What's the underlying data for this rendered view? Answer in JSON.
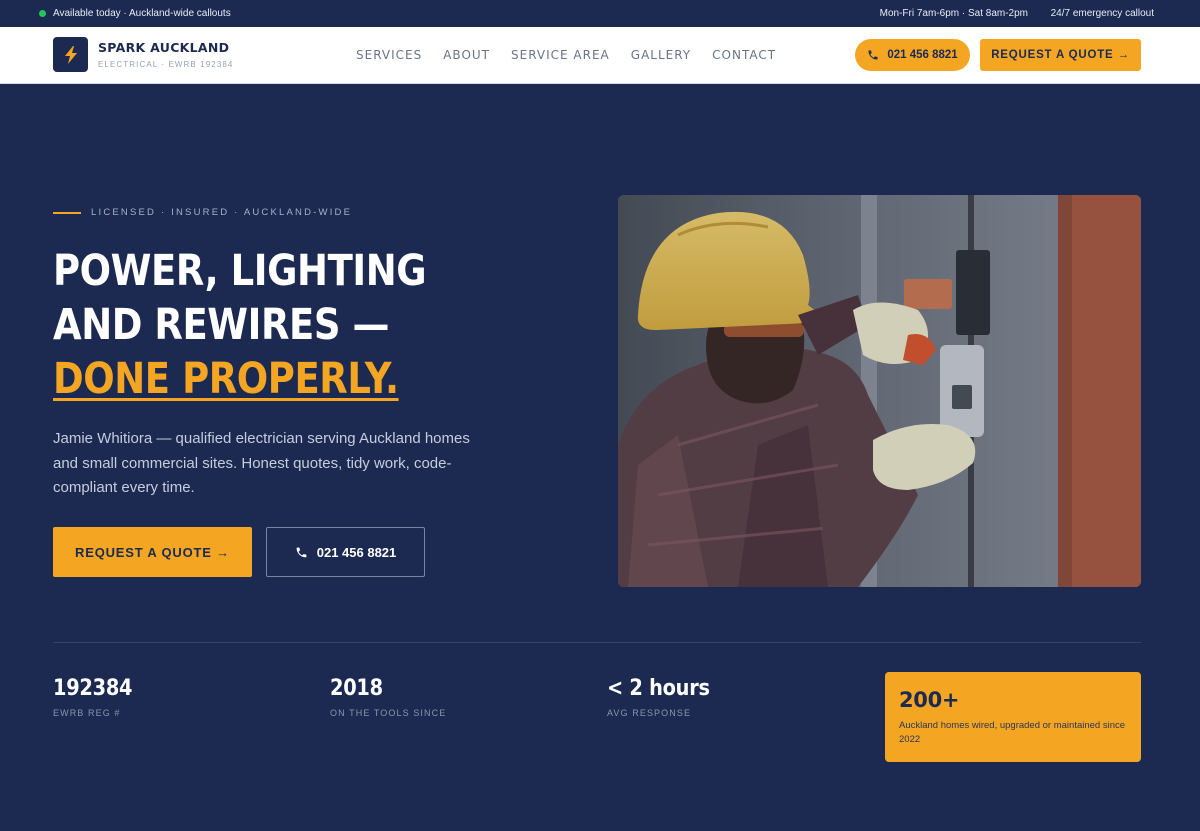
{
  "topbar": {
    "availability": "Available today · Auckland-wide callouts",
    "hours": "Mon-Fri 7am-6pm · Sat 8am-2pm",
    "emergency": "24/7 emergency callout",
    "status_color": "#22c55e"
  },
  "brand": {
    "name": "SPARK AUCKLAND",
    "subtitle": "ELECTRICAL · EWRB 192384",
    "icon": "lightning-bolt-icon"
  },
  "nav": {
    "links": [
      "SERVICES",
      "ABOUT",
      "SERVICE AREA",
      "GALLERY",
      "CONTACT"
    ],
    "phone_label": "021 456 8821",
    "quote_label": "REQUEST A QUOTE →"
  },
  "hero": {
    "kicker": "LICENSED · INSURED · AUCKLAND-WIDE",
    "headline_line1": "POWER, LIGHTING",
    "headline_line2": "AND REWIRES —",
    "headline_accent": "DONE PROPERLY.",
    "lede": "Jamie Whitiora — qualified electrician serving Auckland homes and small commercial sites. Honest quotes, tidy work, code-compliant every time.",
    "primary_cta": "REQUEST A QUOTE →",
    "phone_cta": "021 456 8821",
    "photo_alt": "Electrician in hard hat working on wall wiring"
  },
  "stats": [
    {
      "value": "192384",
      "label": "EWRB REG #"
    },
    {
      "value": "2018",
      "label": "ON THE TOOLS SINCE"
    },
    {
      "value": "< 2 hours",
      "label": "AVG RESPONSE"
    }
  ],
  "highlight": {
    "value": "200+",
    "description": "Auckland homes wired, upgraded or maintained since 2022"
  },
  "colors": {
    "navy": "#1c2a52",
    "accent": "#f4a623",
    "white": "#ffffff"
  }
}
